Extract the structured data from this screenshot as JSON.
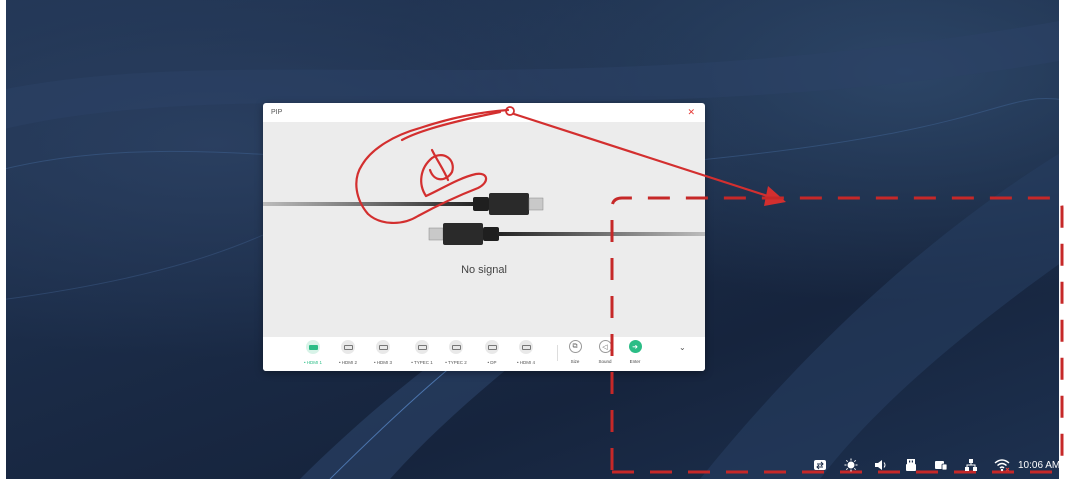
{
  "window": {
    "title": "PIP",
    "close_icon": "close-icon",
    "status": "No signal"
  },
  "sources": [
    {
      "label": "HDMI 1",
      "icon": "hdmi-icon",
      "active": true
    },
    {
      "label": "HDMI 2",
      "icon": "hdmi-icon",
      "active": false
    },
    {
      "label": "HDMI 3",
      "icon": "hdmi-icon",
      "active": false
    },
    {
      "label": "TYPEC 1",
      "icon": "usb-c-icon",
      "active": false
    },
    {
      "label": "TYPEC 2",
      "icon": "usb-c-icon",
      "active": false
    },
    {
      "label": "DP",
      "icon": "displayport-icon",
      "active": false
    },
    {
      "label": "HDMI 4",
      "icon": "hdmi-icon",
      "active": false
    }
  ],
  "actions": [
    {
      "label": "Size",
      "icon": "resize-icon"
    },
    {
      "label": "Sound",
      "icon": "speaker-icon"
    },
    {
      "label": "Enter",
      "icon": "arrow-right-icon"
    }
  ],
  "more_icon": "chevron-down-icon",
  "taskbar": {
    "icons": [
      "swap-icon",
      "brightness-icon",
      "volume-icon",
      "usb-icon",
      "screen-share-icon",
      "network-icon",
      "wifi-icon"
    ],
    "time": "10:06 AM"
  },
  "colors": {
    "accent": "#2bbd86",
    "annotation": "#d32f2f",
    "close": "#e53935"
  }
}
